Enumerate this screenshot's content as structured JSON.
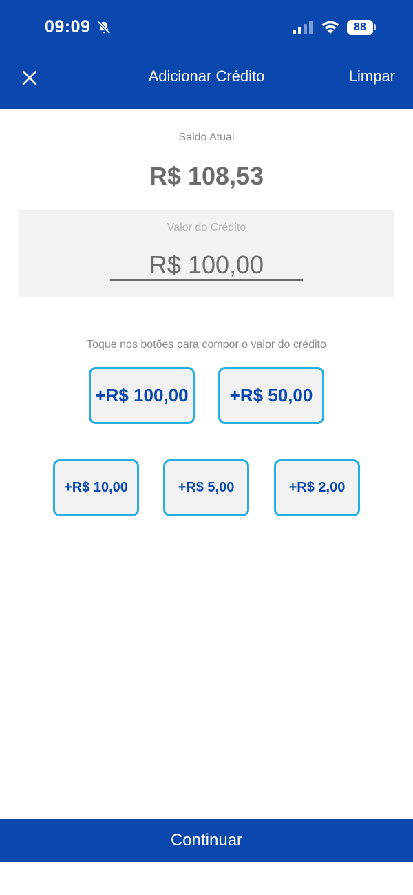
{
  "status_bar": {
    "time": "09:09",
    "battery": "88",
    "icons": [
      "bell-slash-icon",
      "signal-icon",
      "wifi-icon",
      "battery-icon"
    ]
  },
  "nav": {
    "close_icon": "close-icon",
    "title": "Adicionar Crédito",
    "clear_label": "Limpar"
  },
  "balance": {
    "label": "Saldo Atual",
    "value": "R$ 108,53"
  },
  "credit": {
    "label": "Valor do Crédito",
    "value": "R$ 100,00"
  },
  "hint": "Toque nos botões para compor o valor do crédito",
  "quick_buttons": [
    {
      "label": "+R$ 100,00"
    },
    {
      "label": "+R$ 50,00"
    },
    {
      "label": "+R$ 10,00"
    },
    {
      "label": "+R$ 5,00"
    },
    {
      "label": "+R$ 2,00"
    }
  ],
  "continue_label": "Continuar",
  "colors": {
    "primary": "#0b48ad",
    "accent_border": "#25aee5",
    "button_bg": "#f2f2f2",
    "text_gray": "#6b6b6b"
  }
}
